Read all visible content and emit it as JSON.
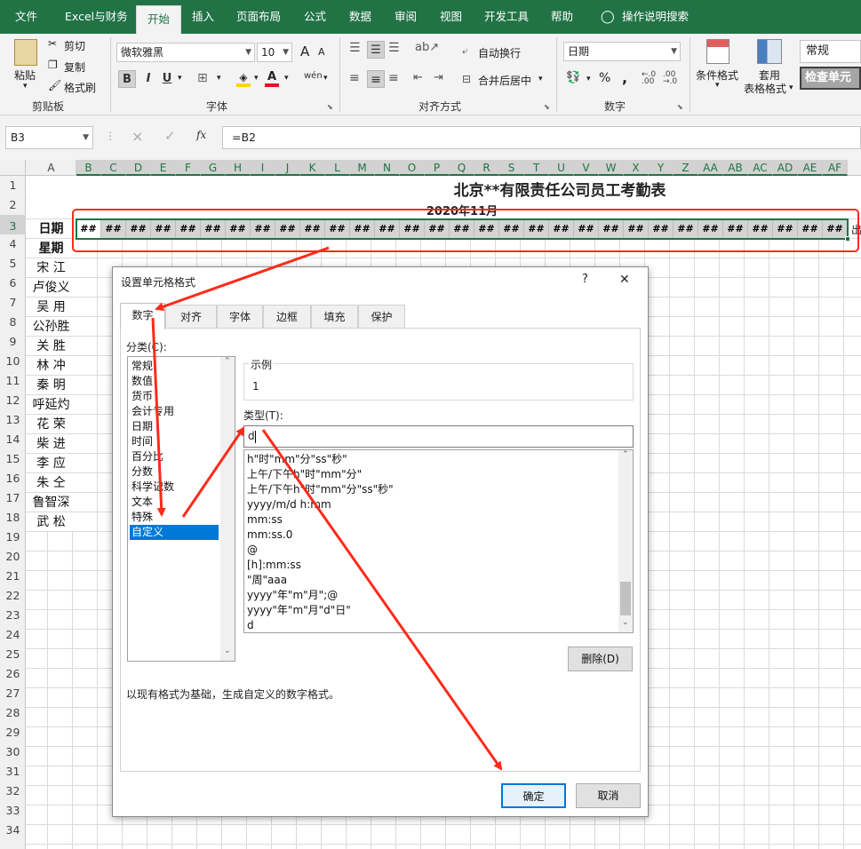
{
  "ribbon_tabs": [
    "文件",
    "Excel与财务",
    "开始",
    "插入",
    "页面布局",
    "公式",
    "数据",
    "审阅",
    "视图",
    "开发工具",
    "帮助",
    "操作说明搜索"
  ],
  "active_tab": "开始",
  "clipboard": {
    "paste": "粘贴",
    "cut": "剪切",
    "copy": "复制",
    "format_painter": "格式刷",
    "title": "剪贴板"
  },
  "font": {
    "name": "微软雅黑",
    "size": "10",
    "bold": "B",
    "italic": "I",
    "underline": "U",
    "title": "字体",
    "wen": "wén",
    "grow": "A",
    "shrink": "A"
  },
  "alignment": {
    "wrap": "自动换行",
    "merge": "合并后居中",
    "title": "对齐方式"
  },
  "number": {
    "format": "日期",
    "title": "数字",
    "percent": "%",
    "comma": ","
  },
  "styles": {
    "conditional": "条件格式",
    "table_l1": "套用",
    "table_l2": "表格格式",
    "normal": "常规",
    "check": "检查单元"
  },
  "formula": {
    "namebox": "B3",
    "content": "=B2",
    "cancel": "×",
    "enter": "✓",
    "fx": "fx"
  },
  "columns": [
    "A",
    "B",
    "C",
    "D",
    "E",
    "F",
    "G",
    "H",
    "I",
    "J",
    "K",
    "L",
    "M",
    "N",
    "O",
    "P",
    "Q",
    "R",
    "S",
    "T",
    "U",
    "V",
    "W",
    "X",
    "Y",
    "Z",
    "AA",
    "AB",
    "AC",
    "AD",
    "AE",
    "AF"
  ],
  "rows": [
    "1",
    "2",
    "3",
    "4",
    "5",
    "6",
    "7",
    "8",
    "9",
    "10",
    "11",
    "12",
    "13",
    "14",
    "15",
    "16",
    "17",
    "18",
    "19",
    "20",
    "21",
    "22",
    "23",
    "24",
    "25",
    "26",
    "27",
    "28",
    "29",
    "30",
    "31",
    "32",
    "33",
    "34"
  ],
  "sheet": {
    "title": "北京**有限责任公司员工考勤表",
    "month": "2020年11月",
    "row3_label": "日期",
    "row4_label": "星期",
    "hash": "##",
    "overflow_char": "出",
    "names": [
      "宋 江",
      "卢俊义",
      "吴 用",
      "公孙胜",
      "关 胜",
      "林 冲",
      "秦 明",
      "呼延灼",
      "花 荣",
      "柴 进",
      "李 应",
      "朱 仝",
      "鲁智深",
      "武 松"
    ]
  },
  "dialog": {
    "title": "设置单元格格式",
    "help": "?",
    "close": "✕",
    "tabs": [
      "数字",
      "对齐",
      "字体",
      "边框",
      "填充",
      "保护"
    ],
    "category_label": "分类(C):",
    "categories": [
      "常规",
      "数值",
      "货币",
      "会计专用",
      "日期",
      "时间",
      "百分比",
      "分数",
      "科学记数",
      "文本",
      "特殊",
      "自定义"
    ],
    "selected_category": "自定义",
    "sample_label": "示例",
    "sample_value": "1",
    "type_label": "类型(T):",
    "type_value": "d",
    "type_list": [
      "h\"时\"mm\"分\"ss\"秒\"",
      "上午/下午h\"时\"mm\"分\"",
      "上午/下午h\"时\"mm\"分\"ss\"秒\"",
      "yyyy/m/d h:mm",
      "mm:ss",
      "mm:ss.0",
      "@",
      "[h]:mm:ss",
      "\"周\"aaa",
      "yyyy\"年\"m\"月\";@",
      "yyyy\"年\"m\"月\"d\"日\"",
      "d"
    ],
    "delete": "删除(D)",
    "description": "以现有格式为基础，生成自定义的数字格式。",
    "ok": "确定",
    "cancel": "取消"
  },
  "colors": {
    "excel_green": "#217346",
    "annotation_red": "#ff2a1a",
    "selection_blue": "#0078d7"
  }
}
